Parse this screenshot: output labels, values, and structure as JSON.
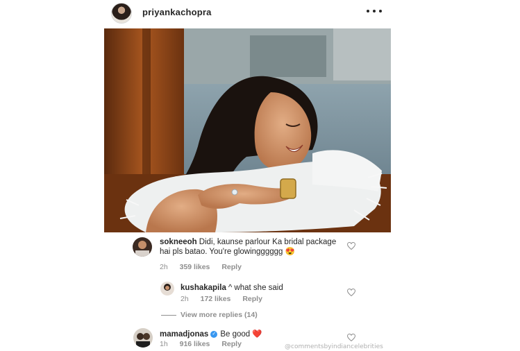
{
  "post": {
    "username": "priyankachopra"
  },
  "comments": [
    {
      "username": "sokneeoh",
      "text": "Didi, kaunse parlour Ka bridal package hai pls batao. You're glowingggggg 😍",
      "time": "2h",
      "likes": "359 likes",
      "reply_label": "Reply"
    },
    {
      "username": "kushakapila",
      "text": "^ what she said",
      "time": "2h",
      "likes": "172 likes",
      "reply_label": "Reply"
    },
    {
      "username": "mamadjonas",
      "text": "Be good ❤️",
      "time": "1h",
      "likes": "916 likes",
      "reply_label": "Reply"
    }
  ],
  "view_more_replies": "View more replies (14)",
  "watermark": "@commentsbyindiancelebrities",
  "colors": {
    "text": "#262626",
    "meta": "#8e8e8e",
    "heart_red": "#ed4956",
    "verified_blue": "#3897f0"
  }
}
